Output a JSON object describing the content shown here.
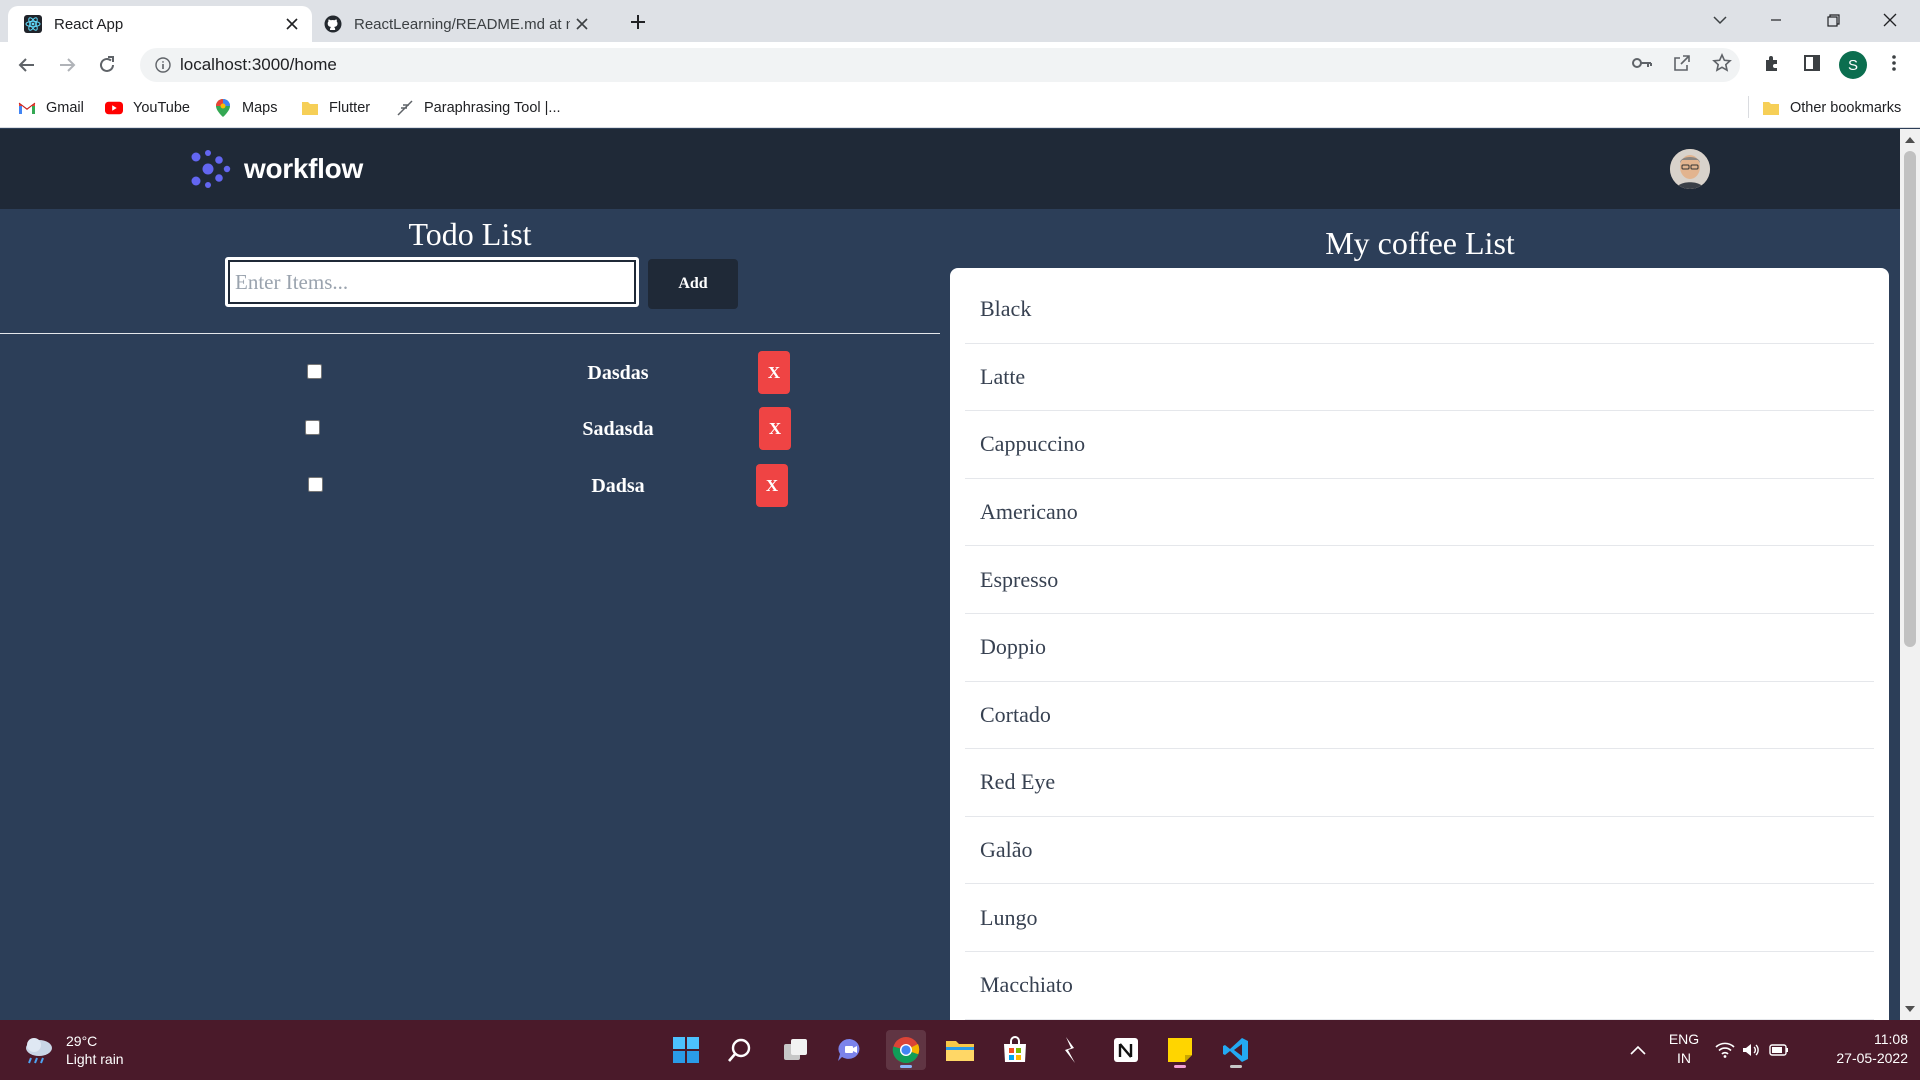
{
  "browser": {
    "tabs": [
      {
        "title": "React App",
        "active": true,
        "favicon": "react-icon"
      },
      {
        "title": "ReactLearning/README.md at m",
        "active": false,
        "favicon": "github-icon"
      }
    ],
    "url": "localhost:3000/home",
    "profile_initial": "S",
    "bookmarks": [
      {
        "label": "Gmail",
        "icon": "gmail-icon"
      },
      {
        "label": "YouTube",
        "icon": "youtube-icon"
      },
      {
        "label": "Maps",
        "icon": "maps-icon"
      },
      {
        "label": "Flutter",
        "icon": "folder-icon"
      },
      {
        "label": "Paraphrasing Tool |...",
        "icon": "feather-icon"
      }
    ],
    "other_bookmarks": "Other bookmarks"
  },
  "app": {
    "brand": "workflow",
    "accent": "#6366f1",
    "header_bg": "#1f2937",
    "page_bg": "#2c3e58"
  },
  "todo": {
    "title": "Todo List",
    "input_placeholder": "Enter Items...",
    "add_label": "Add",
    "delete_label": "X",
    "items": [
      {
        "text": "Dasdas",
        "checked": false
      },
      {
        "text": "Sadasda",
        "checked": false
      },
      {
        "text": "Dadsa",
        "checked": false
      }
    ]
  },
  "coffee": {
    "title": "My coffee List",
    "items": [
      "Black",
      "Latte",
      "Cappuccino",
      "Americano",
      "Espresso",
      "Doppio",
      "Cortado",
      "Red Eye",
      "Galão",
      "Lungo",
      "Macchiato"
    ]
  },
  "taskbar": {
    "weather_temp": "29°C",
    "weather_desc": "Light rain",
    "lang_line1": "ENG",
    "lang_line2": "IN",
    "time": "11:08",
    "date": "27-05-2022"
  }
}
